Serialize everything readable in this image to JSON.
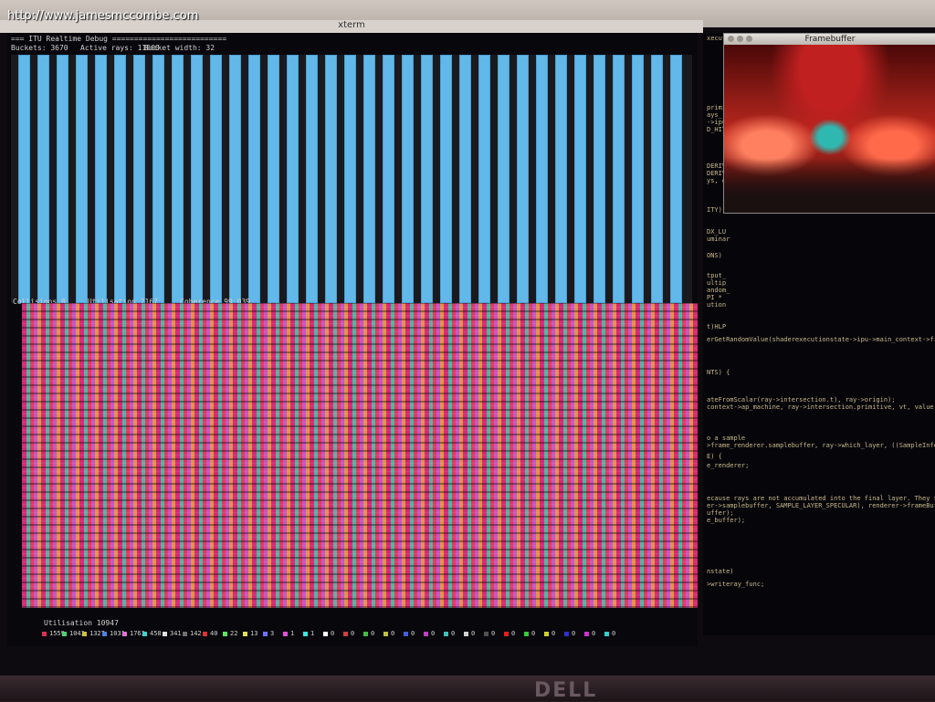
{
  "watermark": "http://www.jamesmccombe.com",
  "window_title": "xterm",
  "debug": {
    "header_title": "=== ITU Realtime Debug ==========================",
    "active_rays": "Active rays: 11000",
    "bucket_width": "Bucket width: 32",
    "buckets": "Buckets: 3670",
    "collisions": "Collisions 0",
    "utilisation": "Utilisation 2167",
    "coherence": "Coherence 99.039",
    "utilisation_bottom": "Utilisation 10947"
  },
  "legend": [
    {
      "value": "1559",
      "color": "#e03050"
    },
    {
      "value": "1043",
      "color": "#50d070"
    },
    {
      "value": "1327",
      "color": "#d0c040"
    },
    {
      "value": "1031",
      "color": "#5080e0"
    },
    {
      "value": "1763",
      "color": "#e070d0"
    },
    {
      "value": "458",
      "color": "#40d0d0"
    },
    {
      "value": "341",
      "color": "#e0e0e0"
    },
    {
      "value": "142",
      "color": "#707070"
    },
    {
      "value": "40",
      "color": "#e03030"
    },
    {
      "value": "22",
      "color": "#60e060"
    },
    {
      "value": "13",
      "color": "#e0e050"
    },
    {
      "value": "3",
      "color": "#7070ff"
    },
    {
      "value": "1",
      "color": "#e050e0"
    },
    {
      "value": "1",
      "color": "#40e0e0"
    },
    {
      "value": "0",
      "color": "#ffffff"
    },
    {
      "value": "0",
      "color": "#d04040"
    },
    {
      "value": "0",
      "color": "#40c040"
    },
    {
      "value": "0",
      "color": "#c0c040"
    },
    {
      "value": "0",
      "color": "#4060e0"
    },
    {
      "value": "0",
      "color": "#c040c0"
    },
    {
      "value": "0",
      "color": "#40c0c0"
    },
    {
      "value": "0",
      "color": "#d0d0d0"
    },
    {
      "value": "0",
      "color": "#505050"
    },
    {
      "value": "0",
      "color": "#e02020"
    },
    {
      "value": "0",
      "color": "#30d030"
    },
    {
      "value": "0",
      "color": "#d0d030"
    },
    {
      "value": "0",
      "color": "#3030d0"
    },
    {
      "value": "0",
      "color": "#d030d0"
    },
    {
      "value": "0",
      "color": "#30d0d0"
    }
  ],
  "framebuffer_title": "Framebuffer",
  "terminal": {
    "lines": [
      "xecut",
      "primi",
      "ays_",
      "->ipu",
      "D_HIT",
      "DERIV",
      "DERIV",
      "ys, d",
      "ITY)",
      "DX_LU",
      "uminar",
      "ONS)",
      "tput_",
      "ultip",
      "andom_",
      "PI *",
      "ution",
      "t)HLP",
      "erGetRandomValue(shaderexecutionstate->ipu->main_context->frame_rend",
      "NTS) {",
      "ateFromScalar(ray->intersection.t), ray->origin);",
      "context->ap_machine, ray->intersection.primitive, vt, value, ray->in",
      "o a sample",
      ">frame_renderer.samplebuffer, ray->which_layer, ((SampleInfo*)(ray-",
      "E) {",
      "e_renderer;",
      "ecause rays are not accumulated into the final layer.  They stay in",
      "er->samplebuffer, SAMPLE_LAYER_SPECULAR), renderer->frameBufferLayer",
      "uffer);",
      "e_buffer);",
      "nstate)",
      ">writeray_func;"
    ]
  },
  "brand": "DELL"
}
